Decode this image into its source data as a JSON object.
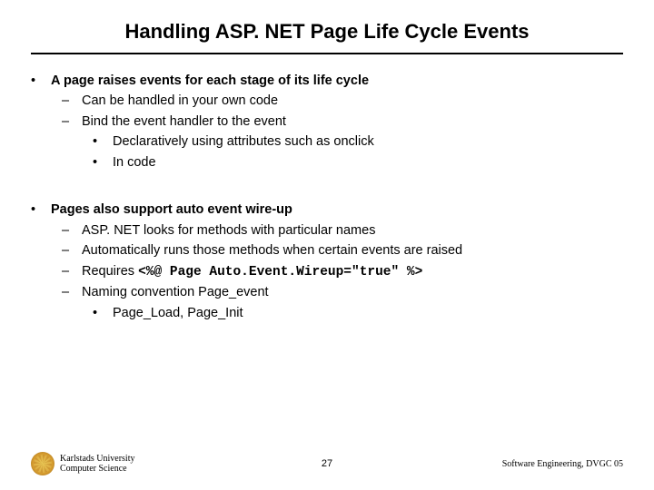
{
  "title": "Handling ASP. NET Page Life Cycle Events",
  "block1": {
    "main": "A page raises events for each stage of its life cycle",
    "sub1": "Can be handled in your own code",
    "sub2": "Bind the event handler to the event",
    "sub2a": "Declaratively using attributes such as onclick",
    "sub2b": "In code"
  },
  "block2": {
    "main": "Pages also support auto event wire-up",
    "sub1": "ASP. NET looks for methods with particular names",
    "sub2": "Automatically runs those methods when certain events are raised",
    "sub3_prefix": "Requires ",
    "sub3_code": "<%@ Page Auto.Event.Wireup=\"true\" %>",
    "sub4": "Naming convention Page_event",
    "sub4a": "Page_Load, Page_Init"
  },
  "footer": {
    "uni1": "Karlstads University",
    "uni2": "Computer Science",
    "page": "27",
    "right": "Software Engineering, DVGC 05"
  }
}
